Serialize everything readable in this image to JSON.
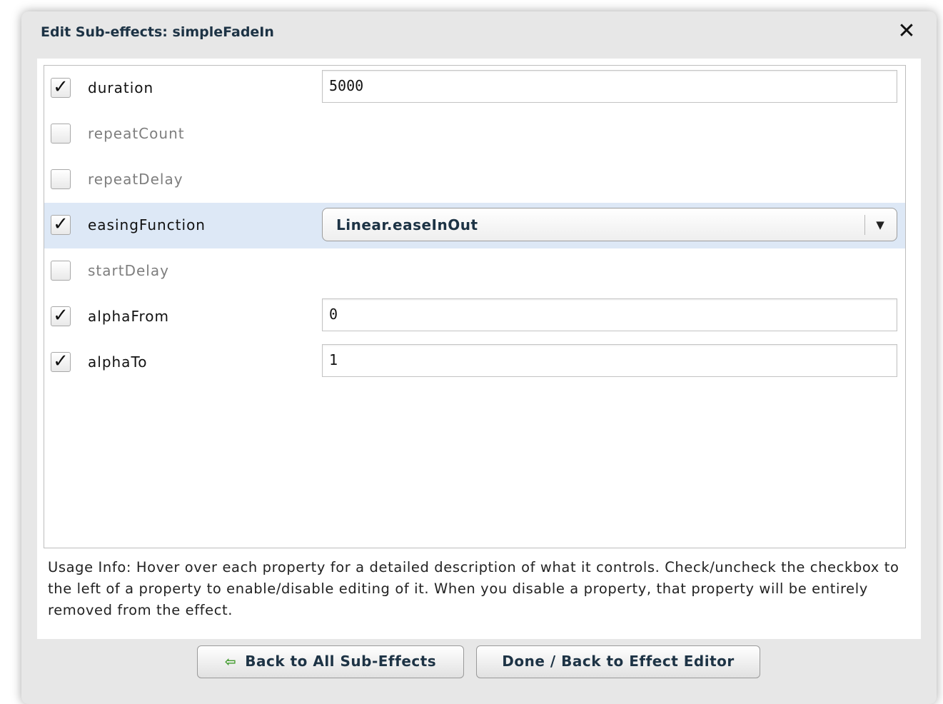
{
  "dialog": {
    "title": "Edit Sub-effects: simpleFadeIn",
    "close_glyph": "✕"
  },
  "properties": [
    {
      "label": "duration",
      "checked": true,
      "control": "text",
      "value": "5000"
    },
    {
      "label": "repeatCount",
      "checked": false,
      "control": "none"
    },
    {
      "label": "repeatDelay",
      "checked": false,
      "control": "none"
    },
    {
      "label": "easingFunction",
      "checked": true,
      "control": "select",
      "value": "Linear.easeInOut",
      "highlighted": true
    },
    {
      "label": "startDelay",
      "checked": false,
      "control": "none"
    },
    {
      "label": "alphaFrom",
      "checked": true,
      "control": "text",
      "value": "0"
    },
    {
      "label": "alphaTo",
      "checked": true,
      "control": "text",
      "value": "1"
    }
  ],
  "checkbox_glyph": "✓",
  "select_arrow_glyph": "▼",
  "usage_info": "Usage Info: Hover over each property for a detailed description of what it controls.  Check/uncheck the checkbox to the left of a property to enable/disable editing of it.  When you disable a property, that property will be entirely removed from the effect.",
  "buttons": {
    "back_label": "Back to All Sub-Effects",
    "back_icon": "⇦",
    "done_label": "Done / Back to Effect Editor"
  },
  "colors": {
    "title_text": "#1d3345",
    "highlight_row": "#dde8f6",
    "back_arrow": "#3f9a2a"
  }
}
